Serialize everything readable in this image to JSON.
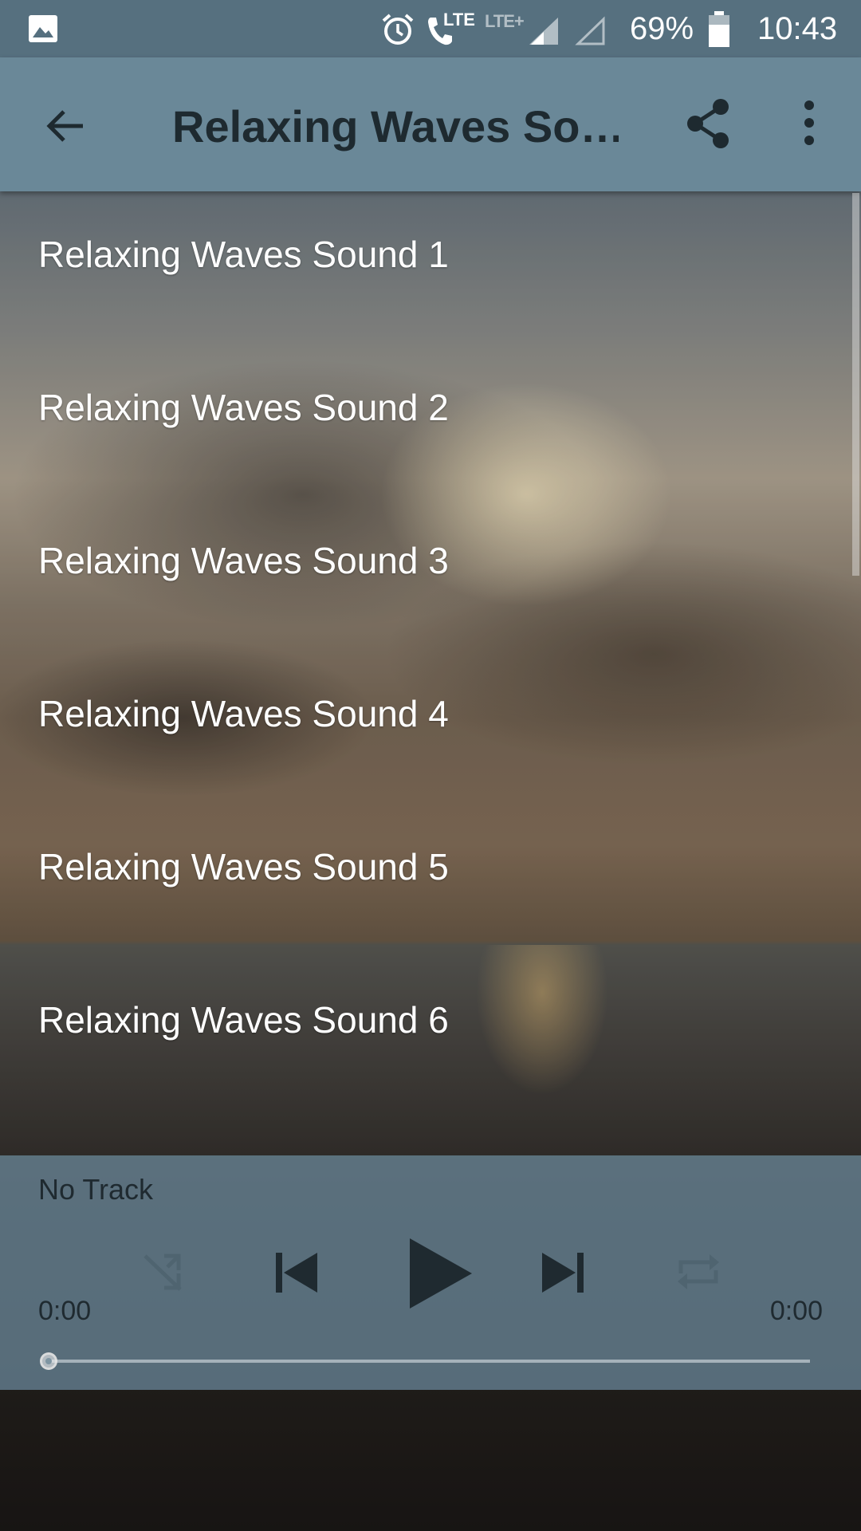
{
  "status_bar": {
    "network_label": "LTE",
    "network_label_2": "LTE+",
    "battery_percent": "69%",
    "time": "10:43",
    "icons": [
      "image-icon",
      "alarm-icon",
      "volte-call-icon",
      "signal-icon",
      "signal-empty-icon",
      "battery-icon"
    ]
  },
  "app_bar": {
    "title": "Relaxing Waves So…",
    "icons": [
      "back-arrow-icon",
      "share-icon",
      "more-vert-icon"
    ]
  },
  "tracks": [
    {
      "label": "Relaxing Waves Sound 1"
    },
    {
      "label": "Relaxing Waves Sound 2"
    },
    {
      "label": "Relaxing Waves Sound 3"
    },
    {
      "label": "Relaxing Waves Sound 4"
    },
    {
      "label": "Relaxing Waves Sound 5"
    },
    {
      "label": "Relaxing Waves Sound 6"
    }
  ],
  "player": {
    "now_playing": "No Track",
    "elapsed": "0:00",
    "duration": "0:00",
    "progress": 0,
    "controls": [
      "shuffle-icon",
      "skip-previous-icon",
      "play-icon",
      "skip-next-icon",
      "repeat-icon"
    ]
  },
  "colors": {
    "status_bar": "#56707f",
    "app_bar": "#6a8898",
    "title_text": "#1e2a30"
  }
}
